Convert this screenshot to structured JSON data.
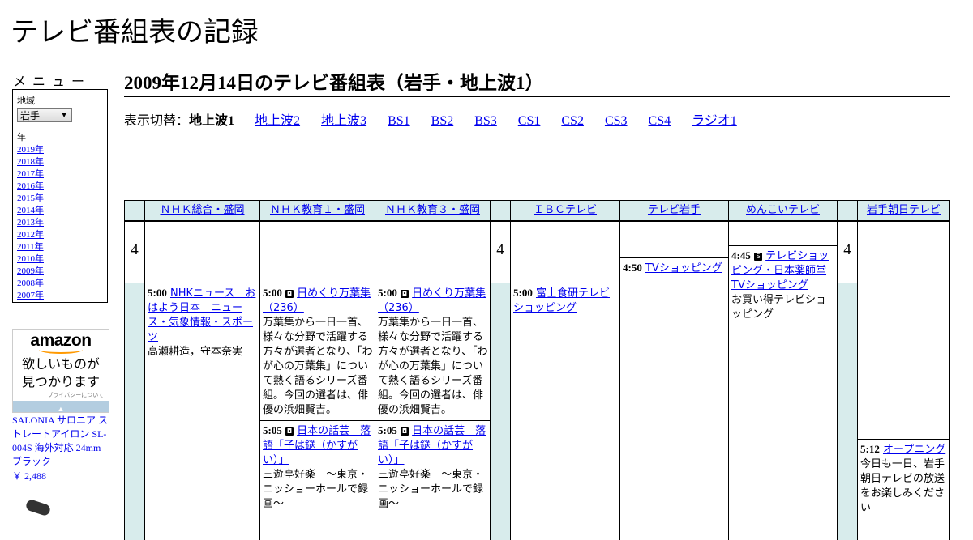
{
  "site_title": "テレビ番組表の記録",
  "menu": {
    "heading": "メニュー",
    "region_label": "地域",
    "region_value": "岩手",
    "year_label": "年",
    "years": [
      "2019年",
      "2018年",
      "2017年",
      "2016年",
      "2015年",
      "2014年",
      "2013年",
      "2012年",
      "2011年",
      "2010年",
      "2009年",
      "2008年",
      "2007年"
    ]
  },
  "ad": {
    "logo": "amazon",
    "copy_line1": "欲しいものが",
    "copy_line2": "見つかります",
    "privacy": "プライバシーについて",
    "product_name": "SALONIA サロニア ストレートアイロン SL-004S 海外対応 24mm ブラック",
    "price": "￥ 2,488"
  },
  "page_heading": "2009年12月14日のテレビ番組表（岩手・地上波1）",
  "switcher": {
    "label": "表示切替：",
    "current": "地上波1",
    "links": [
      "地上波2",
      "地上波3",
      "BS1",
      "BS2",
      "BS3",
      "CS1",
      "CS2",
      "CS3",
      "CS4",
      "ラジオ1"
    ]
  },
  "schedule": {
    "hour": "4",
    "channels": [
      "ＮＨＫ総合・盛岡",
      "ＮＨＫ教育１・盛岡",
      "ＮＨＫ教育３・盛岡",
      "ＩＢＣテレビ",
      "テレビ岩手",
      "めんこいテレビ",
      "岩手朝日テレビ"
    ],
    "programs": {
      "nhk_sogo_1": {
        "time": "5:00",
        "title": "NHKニュース　おはよう日本　ニュース・気象情報・スポーツ",
        "desc": "高瀬耕造，守本奈実"
      },
      "nhk_edu1_1": {
        "time": "5:00",
        "title": "日めくり万葉集（236）",
        "desc": "万葉集から一日一首、様々な分野で活躍する方々が選者となり、「わが心の万葉集」について熱く語るシリーズ番組。今回の選者は、俳優の浜畑賢吉。"
      },
      "nhk_edu1_2": {
        "time": "5:05",
        "title": "日本の話芸　落語「子は鎹（かすがい）」",
        "desc": "三遊亭好楽　～東京・ニッショーホールで録画～"
      },
      "nhk_edu3_1": {
        "time": "5:00",
        "title": "日めくり万葉集（236）",
        "desc": "万葉集から一日一首、様々な分野で活躍する方々が選者となり、「わが心の万葉集」について熱く語るシリーズ番組。今回の選者は、俳優の浜畑賢吉。"
      },
      "nhk_edu3_2": {
        "time": "5:05",
        "title": "日本の話芸　落語「子は鎹（かすがい）」",
        "desc": "三遊亭好楽　～東京・ニッショーホールで録画～"
      },
      "ibc_1": {
        "time": "5:00",
        "title": "富士食研テレビショッピング"
      },
      "tvi_1": {
        "time": "4:50",
        "title": "TVショッピング"
      },
      "menkoi_1": {
        "time": "4:45",
        "title": "テレビショッピング・日本薬師堂TVショッピング",
        "desc": "お買い得テレビショッピング"
      },
      "asahi_1": {
        "time": "5:12",
        "title": "オープニング",
        "desc": "今日も一日、岩手朝日テレビの放送をお楽しみください"
      }
    }
  },
  "colors": {
    "header_bg": "#d8ecec",
    "link": "#0000ee"
  }
}
